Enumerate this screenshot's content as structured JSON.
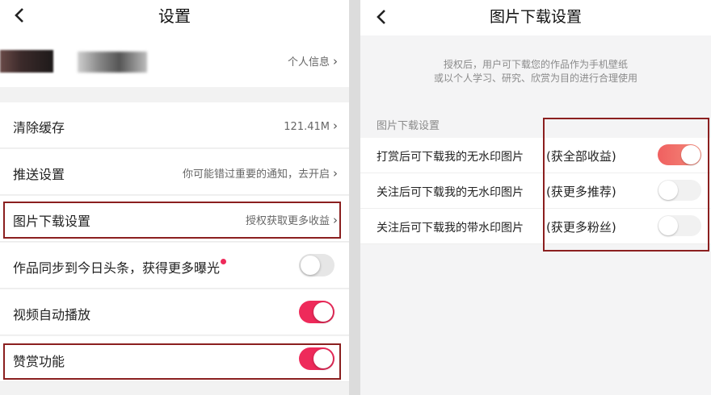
{
  "left": {
    "title": "设置",
    "profile_link": "个人信息",
    "rows": [
      {
        "label": "清除缓存",
        "value": "121.41M"
      },
      {
        "label": "推送设置",
        "value": "你可能错过重要的通知，去开启"
      },
      {
        "label": "图片下载设置",
        "value": "授权获取更多收益"
      },
      {
        "label": "作品同步到今日头条，获得更多曝光",
        "toggle": "off"
      },
      {
        "label": "视频自动播放",
        "toggle": "on"
      },
      {
        "label": "赞赏功能",
        "toggle": "on"
      }
    ],
    "accent": "#ee2a5a"
  },
  "right": {
    "title": "图片下载设置",
    "desc_line1": "授权后，用户可下载您的作品作为手机壁纸",
    "desc_line2": "或以个人学习、研究、欣赏为目的进行合理使用",
    "section": "图片下载设置",
    "rows": [
      {
        "label": "打赏后可下载我的无水印图片",
        "gain": "(获全部收益)",
        "toggle": "on"
      },
      {
        "label": "关注后可下载我的无水印图片",
        "gain": "(获更多推荐)",
        "toggle": "off"
      },
      {
        "label": "关注后可下载我的带水印图片",
        "gain": "(获更多粉丝)",
        "toggle": "off"
      }
    ]
  },
  "icons": {
    "back": "chevron-left-icon",
    "row_arrow": "chevron-right-icon"
  },
  "highlight_color": "#8b1f1f"
}
